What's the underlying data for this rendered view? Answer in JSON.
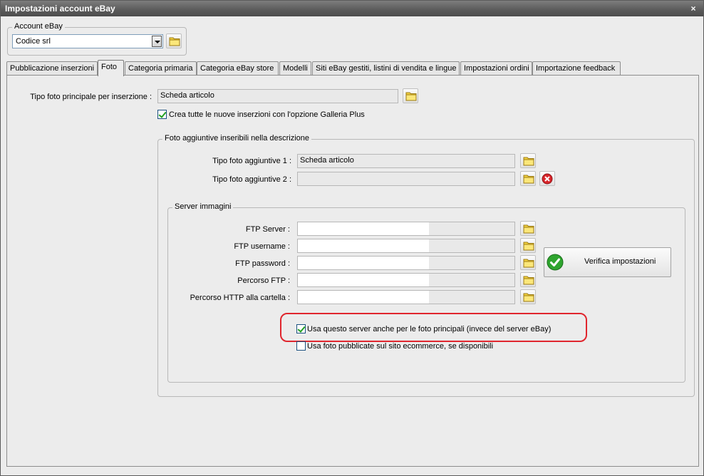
{
  "window": {
    "title": "Impostazioni account eBay",
    "close_glyph": "×"
  },
  "account": {
    "group_label": "Account eBay",
    "selected_value": "Codice srl"
  },
  "tabs": [
    {
      "label": "Pubblicazione inserzioni"
    },
    {
      "label": "Foto"
    },
    {
      "label": "Categoria primaria"
    },
    {
      "label": "Categoria eBay store"
    },
    {
      "label": "Modelli"
    },
    {
      "label": "Siti eBay gestiti, listini di vendita e lingue"
    },
    {
      "label": "Impostazioni ordini"
    },
    {
      "label": "Importazione feedback"
    }
  ],
  "foto": {
    "main_photo_label": "Tipo foto principale per inserzione :",
    "main_photo_value": "Scheda articolo",
    "galleria_plus_label": "Crea tutte le nuove inserzioni con l'opzione Galleria Plus",
    "galleria_plus_checked": true,
    "additional_group_label": "Foto aggiuntive inseribili nella descrizione",
    "additional_1_label": "Tipo foto aggiuntive 1 :",
    "additional_1_value": "Scheda articolo",
    "additional_2_label": "Tipo foto aggiuntive 2 :",
    "additional_2_value": ""
  },
  "server": {
    "group_label": "Server immagini",
    "ftp_server_label": "FTP Server :",
    "ftp_username_label": "FTP username :",
    "ftp_password_label": "FTP password :",
    "ftp_path_label": "Percorso FTP :",
    "http_path_label": "Percorso HTTP alla cartella :",
    "verify_button_label": "Verifica impostazioni",
    "use_server_label": "Usa questo server anche per le foto principali (invece del server eBay)",
    "use_server_checked": true,
    "use_ecommerce_label": "Usa foto pubblicate sul sito ecommerce, se disponibili",
    "use_ecommerce_checked": false
  },
  "icons": {
    "folder": "folder-icon",
    "delete": "delete-icon",
    "check": "check-circle-icon"
  },
  "colors": {
    "highlight": "#e0262e",
    "check_green": "#21a121"
  }
}
